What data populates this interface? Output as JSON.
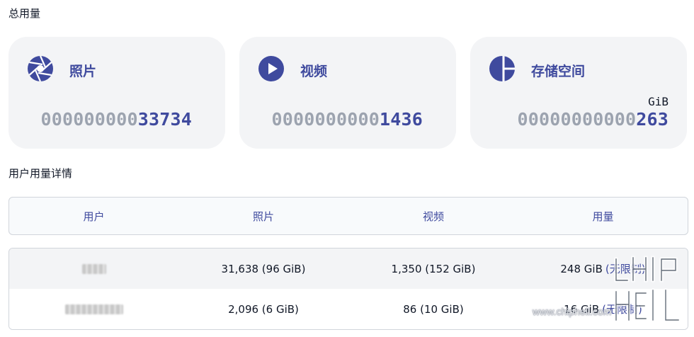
{
  "sections": {
    "total_usage": "总用量",
    "user_usage_details": "用户用量详情"
  },
  "cards": [
    {
      "title": "照片",
      "icon": "aperture-icon",
      "pad": "000000000",
      "value": "33734",
      "unit": ""
    },
    {
      "title": "视频",
      "icon": "play-circle-icon",
      "pad": "0000000000",
      "value": "1436",
      "unit": ""
    },
    {
      "title": "存储空间",
      "icon": "pie-chart-icon",
      "pad": "00000000000",
      "value": "263",
      "unit": "GiB"
    }
  ],
  "table": {
    "headers": [
      "用户",
      "照片",
      "视频",
      "用量"
    ],
    "rows": [
      {
        "user_redacted": true,
        "photos": "31,638 (96 GiB)",
        "videos": "1,350 (152 GiB)",
        "usage": "248 GiB",
        "limit": "(无限制)"
      },
      {
        "user_redacted": true,
        "photos": "2,096 (6 GiB)",
        "videos": "86 (10 GiB)",
        "usage": "16 GiB",
        "limit": "(无限制)"
      }
    ]
  },
  "watermark": {
    "logo": "chiphell-logo",
    "url": "www.chiphell.com"
  },
  "colors": {
    "accent": "#3f4a9e",
    "muted_digits": "#9ca3af",
    "card_bg": "#f3f4f6"
  }
}
